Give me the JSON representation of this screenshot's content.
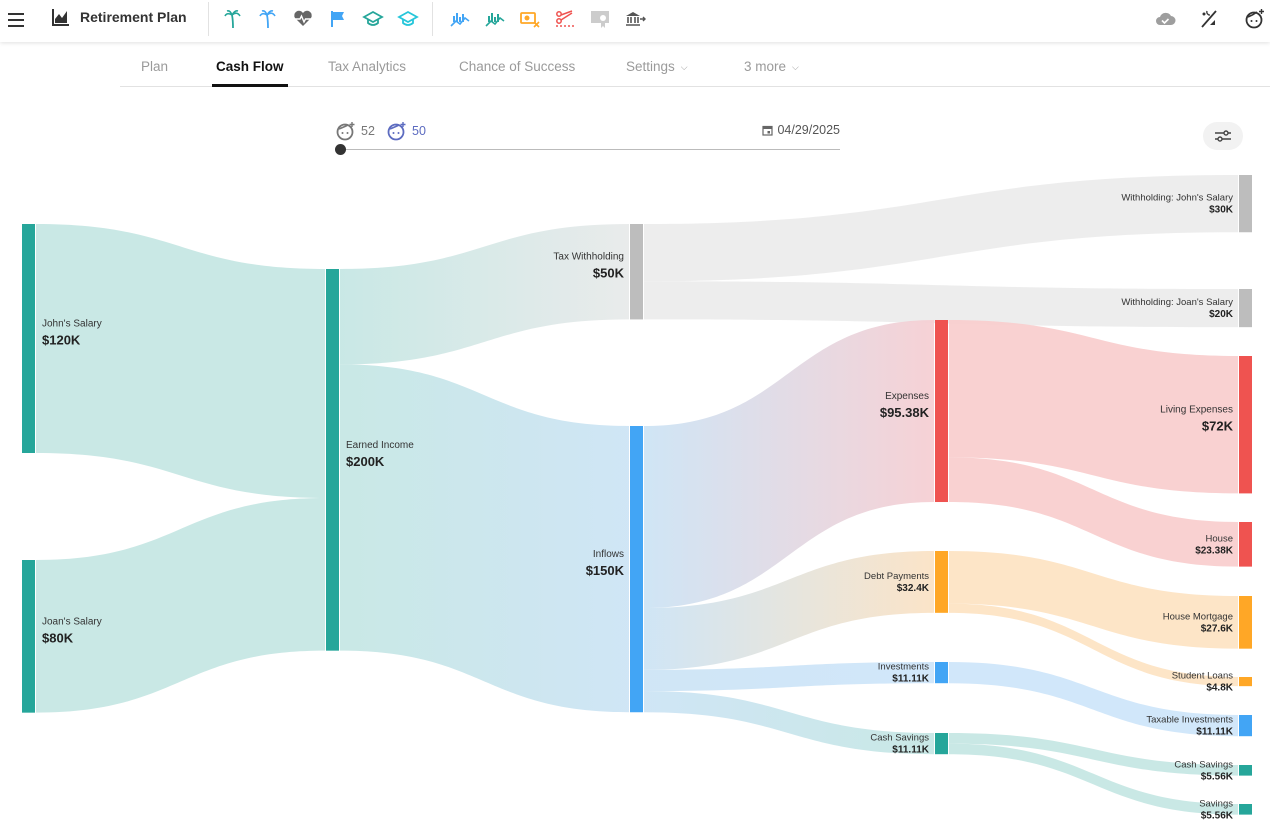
{
  "app": {
    "title": "Retirement Plan"
  },
  "toolbar": {
    "icons": [
      {
        "name": "palm-tree-icon",
        "color": "#26a69a"
      },
      {
        "name": "palm-tree-icon",
        "color": "#42a5f5"
      },
      {
        "name": "heart-pulse-icon",
        "color": "#666666"
      },
      {
        "name": "flag-icon",
        "color": "#42a5f5"
      },
      {
        "name": "graduation-cap-icon",
        "color": "#26a69a"
      },
      {
        "name": "graduation-cap-icon",
        "color": "#26c6da"
      },
      {
        "name": "chart-bars-line-icon",
        "color": "#42a5f5"
      },
      {
        "name": "chart-bars-line-icon",
        "color": "#26a69a"
      },
      {
        "name": "money-cancel-icon",
        "color": "#ffa726"
      },
      {
        "name": "scissors-cut-icon",
        "color": "#ef5350"
      },
      {
        "name": "certificate-icon",
        "color": "#cccccc"
      },
      {
        "name": "bank-transfer-icon",
        "color": "#555555"
      }
    ],
    "right_icons": [
      {
        "name": "cloud-check-icon",
        "color": "#9e9e9e"
      },
      {
        "name": "percent-sleep-icon",
        "color": "#333333"
      },
      {
        "name": "face-account-icon",
        "color": "#333333"
      }
    ]
  },
  "tabs": [
    {
      "label": "Plan",
      "active": false
    },
    {
      "label": "Cash Flow",
      "active": true
    },
    {
      "label": "Tax Analytics",
      "active": false
    },
    {
      "label": "Chance of Success",
      "active": false
    },
    {
      "label": "Settings",
      "active": false,
      "dropdown": true
    },
    {
      "label": "3 more",
      "active": false,
      "dropdown": true
    }
  ],
  "timeline": {
    "person1_age": "52",
    "person1_color": "#777777",
    "person2_age": "50",
    "person2_color": "#5c6bc0",
    "date": "04/29/2025",
    "slider_position": 0
  },
  "chart_data": {
    "type": "sankey",
    "title": "",
    "nodes": [
      {
        "id": "john",
        "label": "John's Salary",
        "value": 120000,
        "display": "$120K",
        "column": 0,
        "color": "#26a69a",
        "big": true
      },
      {
        "id": "joan",
        "label": "Joan's Salary",
        "value": 80000,
        "display": "$80K",
        "column": 0,
        "color": "#26a69a",
        "big": true
      },
      {
        "id": "earned",
        "label": "Earned Income",
        "value": 200000,
        "display": "$200K",
        "column": 1,
        "color": "#26a69a",
        "big": true
      },
      {
        "id": "tax",
        "label": "Tax Withholding",
        "value": 50000,
        "display": "$50K",
        "column": 2,
        "color": "#bdbdbd",
        "big": true
      },
      {
        "id": "inflows",
        "label": "Inflows",
        "value": 150000,
        "display": "$150K",
        "column": 2,
        "color": "#42a5f5",
        "big": true
      },
      {
        "id": "expenses",
        "label": "Expenses",
        "value": 95380,
        "display": "$95.38K",
        "column": 3,
        "color": "#ef5350",
        "big": true
      },
      {
        "id": "debt",
        "label": "Debt Payments",
        "value": 32400,
        "display": "$32.4K",
        "column": 3,
        "color": "#ffa726",
        "big": false
      },
      {
        "id": "invest",
        "label": "Investments",
        "value": 11110,
        "display": "$11.11K",
        "column": 3,
        "color": "#42a5f5",
        "big": false
      },
      {
        "id": "cashsav",
        "label": "Cash Savings",
        "value": 11110,
        "display": "$11.11K",
        "column": 3,
        "color": "#26a69a",
        "big": false
      },
      {
        "id": "wjohn",
        "label": "Withholding: John's Salary",
        "value": 30000,
        "display": "$30K",
        "column": 4,
        "color": "#bdbdbd",
        "big": false
      },
      {
        "id": "wjoan",
        "label": "Withholding: Joan's Salary",
        "value": 20000,
        "display": "$20K",
        "column": 4,
        "color": "#bdbdbd",
        "big": false
      },
      {
        "id": "living",
        "label": "Living Expenses",
        "value": 72000,
        "display": "$72K",
        "column": 4,
        "color": "#ef5350",
        "big": true
      },
      {
        "id": "house",
        "label": "House",
        "value": 23380,
        "display": "$23.38K",
        "column": 4,
        "color": "#ef5350",
        "big": false
      },
      {
        "id": "mortgage",
        "label": "House Mortgage",
        "value": 27600,
        "display": "$27.6K",
        "column": 4,
        "color": "#ffa726",
        "big": false
      },
      {
        "id": "student",
        "label": "Student Loans",
        "value": 4800,
        "display": "$4.8K",
        "column": 4,
        "color": "#ffa726",
        "big": false
      },
      {
        "id": "taxable",
        "label": "Taxable Investments",
        "value": 11110,
        "display": "$11.11K",
        "column": 4,
        "color": "#42a5f5",
        "big": false
      },
      {
        "id": "cashsav2",
        "label": "Cash Savings",
        "value": 5560,
        "display": "$5.56K",
        "column": 4,
        "color": "#26a69a",
        "big": false
      },
      {
        "id": "savings",
        "label": "Savings",
        "value": 5560,
        "display": "$5.56K",
        "column": 4,
        "color": "#26a69a",
        "big": false
      }
    ],
    "links": [
      {
        "source": "john",
        "target": "earned",
        "value": 120000
      },
      {
        "source": "joan",
        "target": "earned",
        "value": 80000
      },
      {
        "source": "earned",
        "target": "tax",
        "value": 50000
      },
      {
        "source": "earned",
        "target": "inflows",
        "value": 150000
      },
      {
        "source": "tax",
        "target": "wjohn",
        "value": 30000
      },
      {
        "source": "tax",
        "target": "wjoan",
        "value": 20000
      },
      {
        "source": "inflows",
        "target": "expenses",
        "value": 95380
      },
      {
        "source": "inflows",
        "target": "debt",
        "value": 32400
      },
      {
        "source": "inflows",
        "target": "invest",
        "value": 11110
      },
      {
        "source": "inflows",
        "target": "cashsav",
        "value": 11110
      },
      {
        "source": "expenses",
        "target": "living",
        "value": 72000
      },
      {
        "source": "expenses",
        "target": "house",
        "value": 23380
      },
      {
        "source": "debt",
        "target": "mortgage",
        "value": 27600
      },
      {
        "source": "debt",
        "target": "student",
        "value": 4800
      },
      {
        "source": "invest",
        "target": "taxable",
        "value": 11110
      },
      {
        "source": "cashsav",
        "target": "cashsav2",
        "value": 5560
      },
      {
        "source": "cashsav",
        "target": "savings",
        "value": 5560
      }
    ]
  }
}
